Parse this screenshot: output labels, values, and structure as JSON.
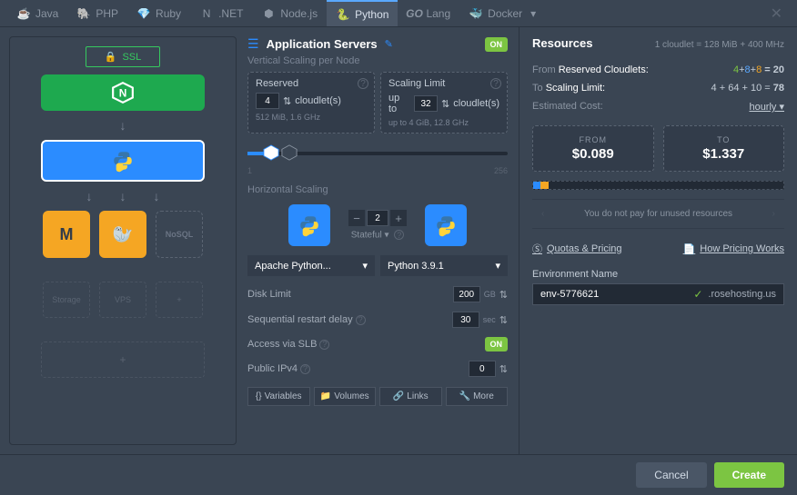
{
  "tabs": [
    "Java",
    "PHP",
    "Ruby",
    ".NET",
    "Node.js",
    "Python",
    "Lang",
    "Docker"
  ],
  "active_tab": "Python",
  "ssl_label": "SSL",
  "topology": {
    "nosql": "NoSQL",
    "storage": "Storage",
    "vps": "VPS",
    "plus": "+"
  },
  "appservers": {
    "title": "Application Servers",
    "toggle": "ON",
    "vertical_label": "Vertical Scaling per Node",
    "reserved": {
      "label": "Reserved",
      "value": "4",
      "unit": "cloudlet(s)",
      "detail": "512 MiB, 1.6 GHz"
    },
    "limit": {
      "label": "Scaling Limit",
      "prefix": "up to",
      "value": "32",
      "unit": "cloudlet(s)",
      "detail": "up to 4 GiB, 12.8 GHz"
    },
    "slider_min": "1",
    "slider_max": "256",
    "horizontal_label": "Horizontal Scaling",
    "horiz_count": "2",
    "stateful": "Stateful",
    "server_dropdown": "Apache Python...",
    "version_dropdown": "Python 3.9.1",
    "disk_limit": {
      "label": "Disk Limit",
      "value": "200",
      "unit": "GB"
    },
    "restart_delay": {
      "label": "Sequential restart delay",
      "value": "30",
      "unit": "sec"
    },
    "slb": {
      "label": "Access via SLB",
      "value": "ON"
    },
    "ipv4": {
      "label": "Public IPv4",
      "value": "0"
    },
    "buttons": [
      "Variables",
      "Volumes",
      "Links",
      "More"
    ]
  },
  "resources": {
    "title": "Resources",
    "cloudlet_def": "1 cloudlet = 128 MiB + 400 MHz",
    "from_label": "From",
    "from_label2": "Reserved Cloudlets:",
    "from_eq": [
      "4",
      "+",
      "8",
      "+",
      "8",
      "= 20"
    ],
    "to_label": "To",
    "to_label2": "Scaling Limit:",
    "to_eq": "4 + 64 + 10 = ",
    "to_total": "78",
    "cost_label": "Estimated Cost:",
    "cost_period": "hourly",
    "from_card": {
      "label": "FROM",
      "amount": "$0.089"
    },
    "to_card": {
      "label": "TO",
      "amount": "$1.337"
    },
    "no_pay": "You do not pay for unused resources",
    "quotas_link": "Quotas & Pricing",
    "howworks_link": "How Pricing Works",
    "env_label": "Environment Name",
    "env_name": "env-5776621",
    "env_domain": ".rosehosting.us"
  },
  "footer": {
    "cancel": "Cancel",
    "create": "Create"
  }
}
